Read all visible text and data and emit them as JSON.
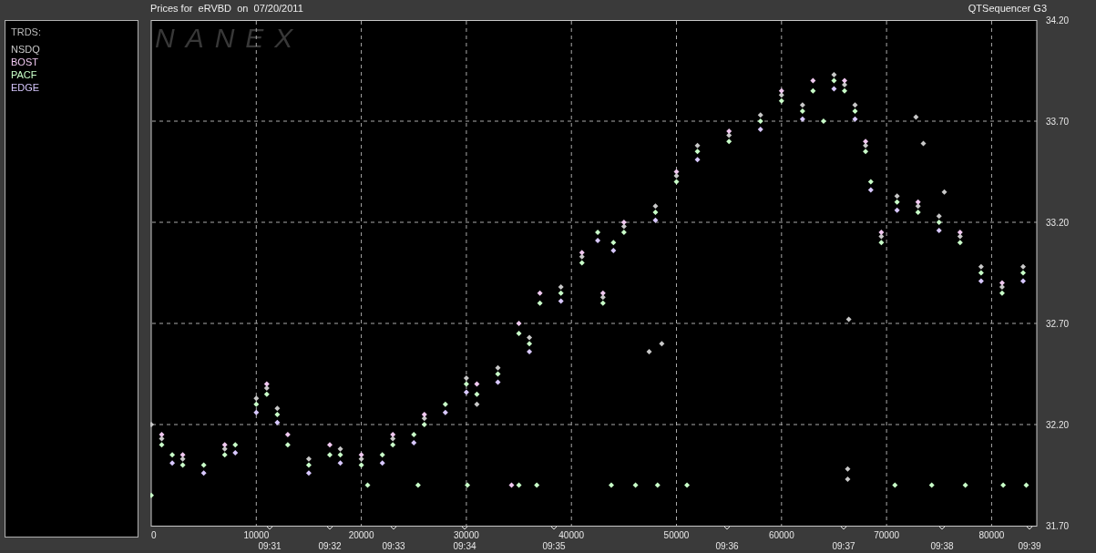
{
  "header": {
    "title": "Prices for  eRVBD  on  07/20/2011",
    "app_name": "QTSequencer G3"
  },
  "legend": {
    "heading": "TRDS:"
  },
  "chart": {
    "logo_text": "NANEX",
    "chart_data": {
      "type": "scatter",
      "xlim": [
        0,
        84300
      ],
      "ylim": [
        31.7,
        34.2
      ],
      "xticks": [
        0,
        10000,
        20000,
        30000,
        40000,
        50000,
        60000,
        70000,
        80000
      ],
      "yticks": [
        {
          "value": 31.7,
          "label": "31.70"
        },
        {
          "value": 32.2,
          "label": "32.20"
        },
        {
          "value": 32.7,
          "label": "32.70"
        },
        {
          "value": 33.2,
          "label": "33.20"
        },
        {
          "value": 33.7,
          "label": "33.70"
        },
        {
          "value": 34.2,
          "label": "34.20"
        }
      ],
      "series": [
        {
          "name": "NSDQ",
          "color": "#c8c8c8",
          "x": [
            0,
            1000,
            3000,
            7000,
            10000,
            11000,
            12000,
            15000,
            18000,
            20000,
            23000,
            26000,
            30000,
            31000,
            33000,
            36000,
            39000,
            41000,
            43000,
            45000,
            48000,
            50000,
            52000,
            55000,
            58000,
            60000,
            62000,
            65000,
            66000,
            67000,
            68000,
            69500,
            71000,
            73000,
            75000,
            77000,
            79000,
            81000,
            83000,
            47400,
            48600,
            66400,
            66300,
            66300,
            72800,
            73500,
            75500
          ],
          "values": [
            32.2,
            32.13,
            32.03,
            32.08,
            32.33,
            32.38,
            32.28,
            32.03,
            32.08,
            32.03,
            32.13,
            32.23,
            32.43,
            32.3,
            32.48,
            32.63,
            32.88,
            33.03,
            32.83,
            33.18,
            33.28,
            33.43,
            33.58,
            33.63,
            33.73,
            33.83,
            33.78,
            33.93,
            33.88,
            33.78,
            33.58,
            33.13,
            33.33,
            33.28,
            33.23,
            33.13,
            32.98,
            32.88,
            32.98,
            32.56,
            32.6,
            32.72,
            31.93,
            31.98,
            33.72,
            33.59,
            33.35
          ]
        },
        {
          "name": "BOST",
          "color": "#f0c8f0",
          "x": [
            1000,
            3000,
            7000,
            11000,
            13000,
            17000,
            20000,
            23000,
            26000,
            31000,
            35000,
            37000,
            41000,
            43000,
            45000,
            50000,
            55000,
            60000,
            63000,
            66000,
            68000,
            69500,
            73000,
            77000,
            81000,
            34300
          ],
          "values": [
            32.15,
            32.05,
            32.1,
            32.4,
            32.15,
            32.1,
            32.05,
            32.15,
            32.25,
            32.4,
            32.7,
            32.85,
            33.05,
            32.85,
            33.2,
            33.45,
            33.65,
            33.85,
            33.9,
            33.9,
            33.6,
            33.15,
            33.3,
            33.15,
            32.9,
            31.9
          ]
        },
        {
          "name": "PACF",
          "color": "#c8ffc8",
          "x": [
            0,
            1000,
            2000,
            3000,
            5000,
            7000,
            8000,
            10000,
            11000,
            12000,
            13000,
            15000,
            17000,
            18000,
            20000,
            22000,
            23000,
            25000,
            26000,
            28000,
            30000,
            31000,
            33000,
            35000,
            36000,
            37000,
            39000,
            41000,
            42500,
            43000,
            44000,
            45000,
            48000,
            50000,
            52000,
            55000,
            58000,
            60000,
            62000,
            63000,
            65000,
            66000,
            67000,
            68000,
            68500,
            69500,
            71000,
            73000,
            75000,
            77000,
            79000,
            81000,
            83000,
            20600,
            25400,
            30100,
            35000,
            36700,
            43800,
            46100,
            48200,
            51000,
            64000,
            70800,
            74300,
            77500,
            81100,
            83300
          ],
          "values": [
            31.85,
            32.1,
            32.05,
            32,
            32,
            32.05,
            32.1,
            32.3,
            32.35,
            32.25,
            32.1,
            32,
            32.05,
            32.05,
            32,
            32.05,
            32.1,
            32.15,
            32.2,
            32.3,
            32.4,
            32.35,
            32.45,
            32.65,
            32.6,
            32.8,
            32.85,
            33,
            33.15,
            32.8,
            33.1,
            33.15,
            33.25,
            33.4,
            33.55,
            33.6,
            33.7,
            33.8,
            33.75,
            33.85,
            33.9,
            33.85,
            33.75,
            33.55,
            33.4,
            33.1,
            33.3,
            33.25,
            33.2,
            33.1,
            32.95,
            32.85,
            32.95,
            31.9,
            31.9,
            31.9,
            31.9,
            31.9,
            31.9,
            31.9,
            31.9,
            31.9,
            33.7,
            31.9,
            31.9,
            31.9,
            31.9,
            31.9
          ]
        },
        {
          "name": "EDGE",
          "color": "#d8c8ff",
          "x": [
            2000,
            5000,
            8000,
            10000,
            12000,
            15000,
            18000,
            22000,
            25000,
            28000,
            30000,
            33000,
            36000,
            39000,
            42500,
            44000,
            48000,
            52000,
            58000,
            62000,
            65000,
            67000,
            68500,
            71000,
            75000,
            79000,
            83000
          ],
          "values": [
            32.01,
            31.96,
            32.06,
            32.26,
            32.21,
            31.96,
            32.01,
            32.01,
            32.11,
            32.26,
            32.36,
            32.41,
            32.56,
            32.81,
            33.11,
            33.06,
            33.21,
            33.51,
            33.66,
            33.71,
            33.86,
            33.71,
            33.36,
            33.26,
            33.16,
            32.91,
            32.91
          ]
        }
      ],
      "grid": true
    },
    "time_labels": [
      "09:31",
      "09:32",
      "09:33",
      "09:34",
      "09:35",
      "09:36",
      "09:37",
      "09:38",
      "09:39"
    ]
  }
}
